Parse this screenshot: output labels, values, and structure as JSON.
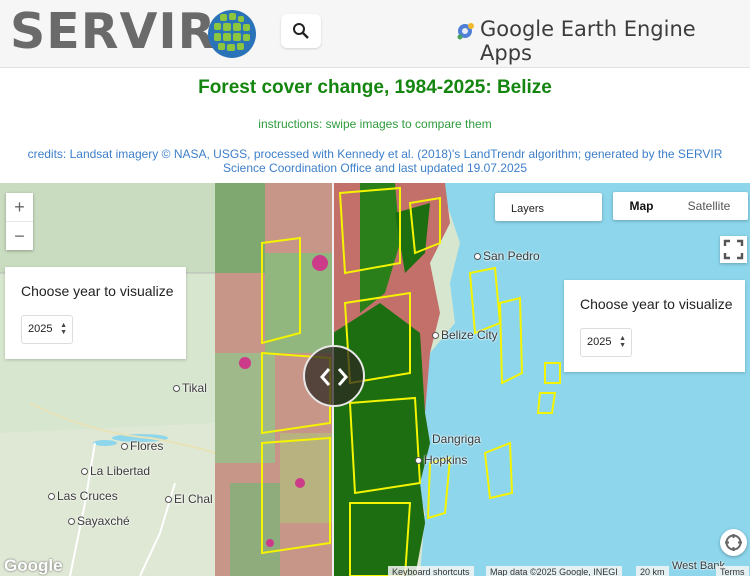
{
  "header": {
    "logo_text": "SERVIR",
    "app_title": "Google Earth Engine Apps"
  },
  "page": {
    "title": "Forest cover change, 1984-2025: Belize",
    "instructions": "instructions: swipe images to compare them",
    "credits": "credits: Landsat imagery © NASA, USGS, processed with Kennedy et al. (2018)'s LandTrendr algorithm; generated by the SERVIR Science Coordination Office and last updated 19.07.2025"
  },
  "map": {
    "zoom_in": "+",
    "zoom_out": "−",
    "layers_label": "Layers",
    "map_type_map": "Map",
    "map_type_satellite": "Satellite",
    "left_panel": {
      "label": "Choose year to visualize",
      "year": "2025"
    },
    "right_panel": {
      "label": "Choose year to visualize",
      "year": "2025"
    },
    "places": {
      "san_pedro": "San Pedro",
      "belize_city": "Belize City",
      "dangriga": "Dangriga",
      "hopkins": "Hopkins",
      "tikal": "Tikal",
      "flores": "Flores",
      "la_libertad": "La Libertad",
      "las_cruces": "Las Cruces",
      "el_chal": "El Chal",
      "sayaxche": "Sayaxché",
      "west_bank": "West Bank"
    },
    "google_logo": "Google",
    "keyboard_shortcuts": "Keyboard shortcuts",
    "map_data": "Map data ©2025 Google, INEGI",
    "scale": "20 km",
    "terms": "Terms"
  },
  "icons": {
    "search": "search-icon",
    "globe": "globe-logo-icon",
    "gee": "earth-engine-icon",
    "fullscreen": "fullscreen-icon",
    "swipe": "swipe-arrows-icon",
    "pegman": "street-view-icon"
  },
  "colors": {
    "title_green": "#14860f",
    "credits_blue": "#3d7fc9",
    "forest_green": "#1c6e10",
    "deforested_red": "#c4706a",
    "protected_area_yellow": "#f4f400",
    "water": "#8dd6ec"
  }
}
